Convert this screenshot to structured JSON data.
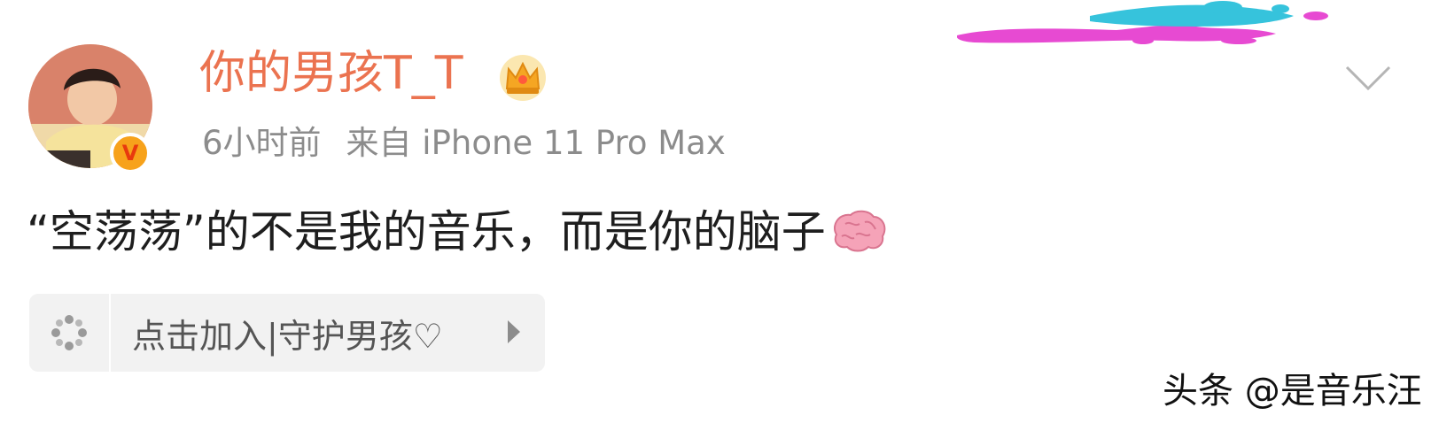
{
  "post": {
    "username": "你的男孩T_T",
    "time": "6小时前",
    "source": "来自 iPhone 11 Pro Max",
    "text": "“空荡荡”的不是我的音乐，而是你的脑子",
    "emoji": "brain-emoji"
  },
  "super_topic": {
    "label": "点击加入|守护男孩♡"
  },
  "badges": {
    "verified": "V"
  },
  "watermark": {
    "text": "头条 @是音乐汪"
  },
  "colors": {
    "username": "#eb7350",
    "meta": "#8c8c8c",
    "verified_badge": "#f7a21b",
    "crown": "#f5a623",
    "super_topic_bg": "#f2f2f2"
  },
  "icons": [
    "avatar-photo",
    "verified-v-badge",
    "crown-icon",
    "chevron-down-icon",
    "brain-emoji",
    "super-topic-icon",
    "arrow-right-icon",
    "paint-splash-decoration"
  ]
}
